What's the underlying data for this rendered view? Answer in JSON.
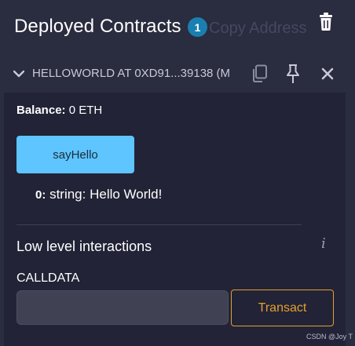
{
  "header": {
    "title": "Deployed Contracts",
    "count": "1",
    "ghost_text": "Copy Address"
  },
  "contract": {
    "name": "HELLOWORLD AT 0XD91...39138 (M",
    "balance_label": "Balance:",
    "balance_value": " 0 ETH",
    "function_button": "sayHello",
    "result_index": "0:",
    "result_value": " string: Hello World!",
    "low_level_title": "Low level interactions",
    "calldata_label": "CALLDATA",
    "calldata_value": "",
    "transact_label": "Transact"
  },
  "icons": {
    "trash": "trash-icon",
    "chevron": "chevron-down-icon",
    "copy": "copy-icon",
    "pin": "pin-icon",
    "close": "close-icon",
    "info": "info-icon"
  },
  "watermark": "CSDN @Joy T",
  "colors": {
    "background": "#2a2c3f",
    "card": "#222336",
    "badge": "#1a7fb0",
    "primary_button": "#5ec5ff",
    "transact": "#e3a02f"
  }
}
